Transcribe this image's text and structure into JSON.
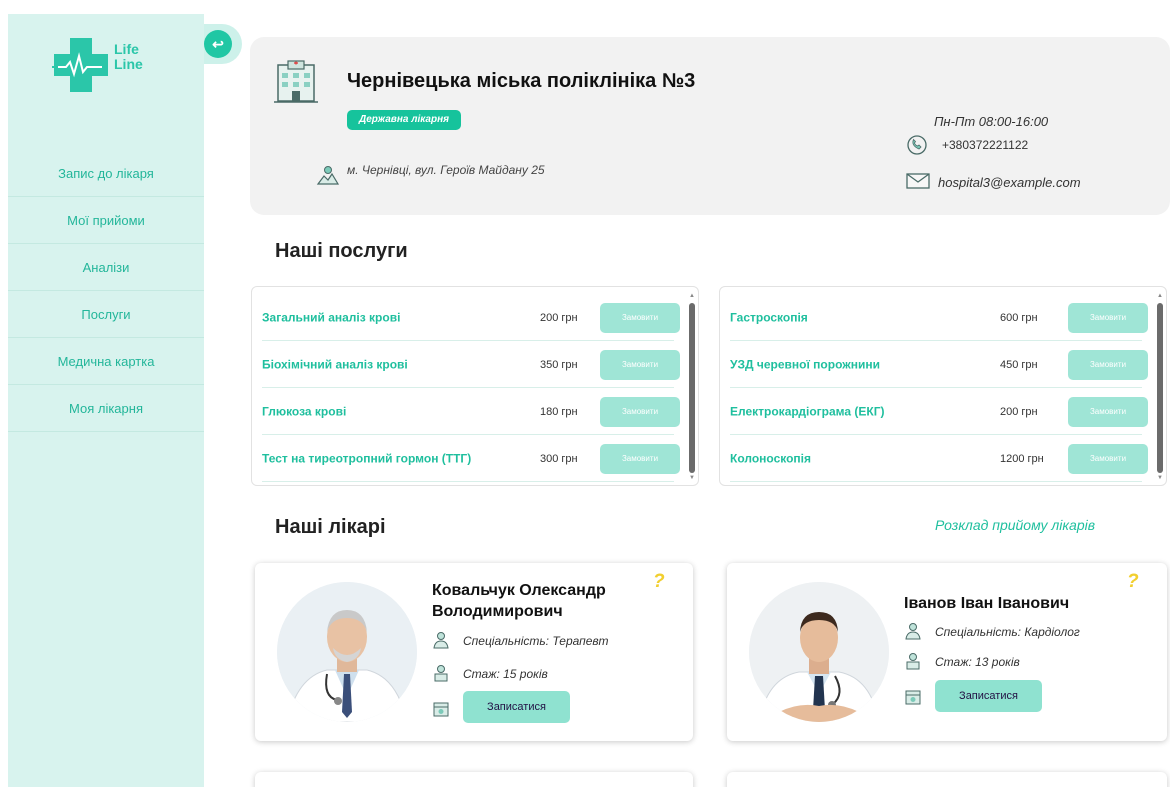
{
  "sidebar": {
    "logo": {
      "line1": "Life",
      "line2": "Line",
      "color": "#2bc6a9"
    },
    "items": [
      {
        "label": "Запис до лікаря"
      },
      {
        "label": "Мої прийоми"
      },
      {
        "label": "Аналізи"
      },
      {
        "label": "Послуги"
      },
      {
        "label": "Медична картка"
      },
      {
        "label": "Моя лікарня"
      }
    ]
  },
  "back_button": {
    "icon": "return-arrow-icon",
    "glyph": "↩"
  },
  "hospital": {
    "name": "Чернівецька міська поліклініка №3",
    "type_badge": "Державна лікарня",
    "address": "м. Чернівці, вул. Героїв Майдану 25",
    "hours": "Пн-Пт 08:00-16:00",
    "phone": "+380372221122",
    "email": "hospital3@example.com"
  },
  "services": {
    "title": "Наші послуги",
    "left": [
      {
        "name": "Загальний аналіз крові",
        "price": "200 грн",
        "button": "Замовити"
      },
      {
        "name": "Біохімічний аналіз крові",
        "price": "350 грн",
        "button": "Замовити"
      },
      {
        "name": "Глюкоза крові",
        "price": "180 грн",
        "button": "Замовити"
      },
      {
        "name": "Тест на тиреотропний гормон (ТТГ)",
        "price": "300 грн",
        "button": "Замовити"
      }
    ],
    "right": [
      {
        "name": "Гастроскопія",
        "price": "600 грн",
        "button": "Замовити"
      },
      {
        "name": "УЗД черевної порожнини",
        "price": "450 грн",
        "button": "Замовити"
      },
      {
        "name": "Електрокардіограма (ЕКГ)",
        "price": "200 грн",
        "button": "Замовити"
      },
      {
        "name": "Колоноскопія",
        "price": "1200 грн",
        "button": "Замовити"
      }
    ]
  },
  "doctors": {
    "title": "Наші лікарі",
    "schedule_link": "Розклад прийому лікарів",
    "items": [
      {
        "name": "Ковальчук Олександр Володимирович",
        "specialty": "Спеціальність: Терапевт",
        "experience": "Стаж: 15 років",
        "button": "Записатися",
        "help": "?"
      },
      {
        "name": "Іванов Іван Іванович",
        "specialty": "Спеціальність: Кардіолог",
        "experience": "Стаж: 13 років",
        "button": "Записатися",
        "help": "?"
      }
    ]
  },
  "colors": {
    "accent": "#1fbf9e",
    "sidebar_bg": "#d8f3ee",
    "badge": "#16c39c",
    "help": "#f2cf2f"
  }
}
